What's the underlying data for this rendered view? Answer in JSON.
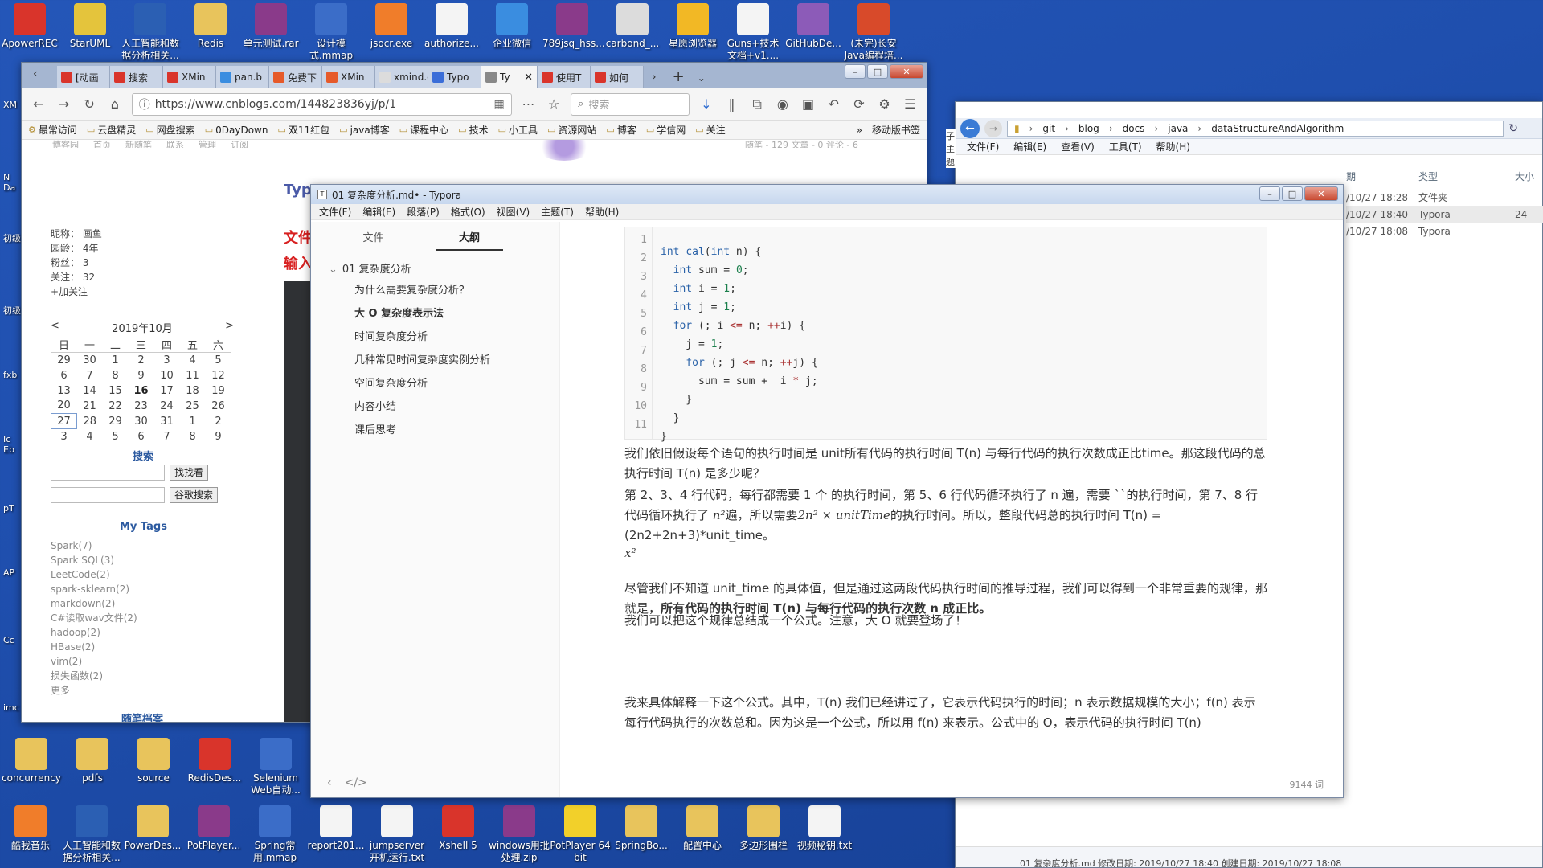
{
  "desktop": {
    "top_icons": [
      {
        "label": "ApowerREC",
        "color": "#d9342b"
      },
      {
        "label": "StarUML",
        "color": "#e4c43c"
      },
      {
        "label": "人工智能和数据分析相关...",
        "color": "#2b5fb3"
      },
      {
        "label": "Redis",
        "color": "#e8c45c"
      },
      {
        "label": "单元测试.rar",
        "color": "#8a3a8a"
      },
      {
        "label": "设计模式.mmap",
        "color": "#3b6dc8"
      },
      {
        "label": "jsocr.exe",
        "color": "#f07d2a"
      },
      {
        "label": "authorize...",
        "color": "#f4f4f4"
      },
      {
        "label": "企业微信",
        "color": "#3a8de0"
      },
      {
        "label": "789jsq_hss...",
        "color": "#8a3a8a"
      },
      {
        "label": "carbond_...",
        "color": "#dcdcdc"
      },
      {
        "label": "星愿浏览器",
        "color": "#f2b825"
      },
      {
        "label": "Guns+技术文档+v1....",
        "color": "#f4f4f4"
      },
      {
        "label": "GitHubDe...",
        "color": "#8c5bb8"
      },
      {
        "label": "(未完)长安Java编程培...",
        "color": "#d84a2a"
      }
    ],
    "left_edge_labels": [
      "XM",
      "N Da",
      "初级",
      "初级",
      "fxb",
      "Ic Eb",
      "pT",
      "AP",
      "Cc",
      "imc"
    ],
    "mid_icons": [
      {
        "label": "concurrency",
        "color": "#e8c45c"
      },
      {
        "label": "pdfs",
        "color": "#e8c45c"
      },
      {
        "label": "source",
        "color": "#e8c45c"
      },
      {
        "label": "RedisDes...",
        "color": "#d9342b"
      },
      {
        "label": "Selenium Web自动...",
        "color": "#3b6dc8"
      }
    ],
    "bottom_icons": [
      {
        "label": "酷我音乐",
        "color": "#f07d2a"
      },
      {
        "label": "人工智能和数据分析相关...",
        "color": "#2b5fb3"
      },
      {
        "label": "PowerDes...",
        "color": "#e8c45c"
      },
      {
        "label": "PotPlayer...",
        "color": "#8a3a8a"
      },
      {
        "label": "Spring常用.mmap",
        "color": "#3b6dc8"
      },
      {
        "label": "report201...",
        "color": "#f4f4f4"
      },
      {
        "label": "jumpserver开机运行.txt",
        "color": "#f4f4f4"
      },
      {
        "label": "Xshell 5",
        "color": "#d9342b"
      },
      {
        "label": "windows用批处理.zip",
        "color": "#8a3a8a"
      },
      {
        "label": "PotPlayer 64 bit",
        "color": "#f2d02a"
      },
      {
        "label": "SpringBo...",
        "color": "#e8c45c"
      },
      {
        "label": "配置中心",
        "color": "#e8c45c"
      },
      {
        "label": "多边形围栏",
        "color": "#e8c45c"
      },
      {
        "label": "视频秘钥.txt",
        "color": "#f4f4f4"
      }
    ]
  },
  "firefox": {
    "tabs": [
      {
        "label": "[动画",
        "color": "#d9342b"
      },
      {
        "label": "搜索",
        "color": "#d9342b"
      },
      {
        "label": "XMin",
        "color": "#d9342b"
      },
      {
        "label": "pan.b",
        "color": "#3a8de0"
      },
      {
        "label": "免费下",
        "color": "#e65a2a"
      },
      {
        "label": "XMin",
        "color": "#e65a2a"
      },
      {
        "label": "xmind.cn",
        "color": "#dcdcdc"
      },
      {
        "label": "Typo",
        "color": "#3a6dd8"
      },
      {
        "label": "Ty",
        "color": "#888"
      },
      {
        "label": "使用T",
        "color": "#d9342b"
      },
      {
        "label": "如何",
        "color": "#d9342b"
      }
    ],
    "url": "https://www.cnblogs.com/144823836yj/p/1",
    "search_placeholder": "搜索",
    "bookmarks": [
      "最常访问",
      "云盘精灵",
      "网盘搜索",
      "0DayDown",
      "双11红包",
      "java博客",
      "课程中心",
      "技术",
      "小工具",
      "资源网站",
      "博客",
      "学信网",
      "关注"
    ],
    "mobile_bookmarks": "移动版书签",
    "blog": {
      "nav": [
        "博客园",
        "首页",
        "新随笔",
        "联系",
        "管理",
        "订阅"
      ],
      "stats": "随笔 - 129  文章 - 0  评论 - 6",
      "profile": [
        "昵称： 画鱼",
        "园龄： 4年",
        "粉丝： 3",
        "关注： 32",
        "+加关注"
      ],
      "calendar_title": "2019年10月",
      "weekdays": [
        "日",
        "一",
        "二",
        "三",
        "四",
        "五",
        "六"
      ],
      "weeks": [
        [
          "29",
          "30",
          "1",
          "2",
          "3",
          "4",
          "5"
        ],
        [
          "6",
          "7",
          "8",
          "9",
          "10",
          "11",
          "12"
        ],
        [
          "13",
          "14",
          "15",
          "16",
          "17",
          "18",
          "19"
        ],
        [
          "20",
          "21",
          "22",
          "23",
          "24",
          "25",
          "26"
        ],
        [
          "27",
          "28",
          "29",
          "30",
          "31",
          "1",
          "2"
        ],
        [
          "3",
          "4",
          "5",
          "6",
          "7",
          "8",
          "9"
        ]
      ],
      "search_title": "搜索",
      "btn_search": "找找看",
      "btn_google": "谷歌搜索",
      "tags_title": "My Tags",
      "tags": [
        "Spark(7)",
        "Spark SQL(3)",
        "LeetCode(2)",
        "spark-sklearn(2)",
        "markdown(2)",
        "C#读取wav文件(2)",
        "hadoop(2)",
        "HBase(2)",
        "vim(2)",
        "损失函数(2)",
        "更多"
      ],
      "archive_title": "随笔档案",
      "peek_title": "Typ",
      "peek_red1": "文件",
      "peek_red2": "输入"
    }
  },
  "typora": {
    "title": "01 复杂度分析.md• - Typora",
    "menu": [
      "文件(F)",
      "编辑(E)",
      "段落(P)",
      "格式(O)",
      "视图(V)",
      "主题(T)",
      "帮助(H)"
    ],
    "side_tabs": [
      "文件",
      "大纲"
    ],
    "outline_root": "01 复杂度分析",
    "outline": [
      "为什么需要复杂度分析？",
      "大 O 复杂度表示法",
      "时间复杂度分析",
      "几种常见时间复杂度实例分析",
      "空间复杂度分析",
      "内容小结",
      "课后思考"
    ],
    "code_lines": [
      "1",
      "2",
      "3",
      "4",
      "5",
      "6",
      "7",
      "8",
      "9",
      "10",
      "11"
    ],
    "p1": "我们依旧假设每个语句的执行时间是 unit所有代码的执行时间 T(n) 与每行代码的执行次数成正比time。那这段代码的总执行时间 T(n) 是多少呢？",
    "p2a": "第 2、3、4 行代码，每行都需要 1 个 的执行时间，第 5、6 行代码循环执行了 n 遍，需要 ``的执行时间，第 7、8 行代码循环执行了 ",
    "p2_math1": "n²",
    "p2b": "遍，所以需要",
    "p2_math2": "2n² × unitTime",
    "p2c": "的执行时间。所以，整段代码总的执行时间 T(n) = (2n2+2n+3)*unit_time。",
    "math_x2": "x²",
    "p3a": "尽管我们不知道 unit_time 的具体值，但是通过这两段代码执行时间的推导过程，我们可以得到一个非常重要的规律，那就是，",
    "p3b": "所有代码的执行时间 T(n) 与每行代码的执行次数 n 成正比。",
    "p4": "我们可以把这个规律总结成一个公式。注意，大 O 就要登场了！",
    "p5": "我来具体解释一下这个公式。其中，T(n) 我们已经讲过了，它表示代码执行的时间；n 表示数据规模的大小；f(n) 表示每行代码执行的次数总和。因为这是一个公式，所以用 f(n) 来表示。公式中的 O，表示代码的执行时间 T(n)",
    "word_count": "9144 词"
  },
  "explorer": {
    "path": [
      "git",
      "blog",
      "docs",
      "java",
      "dataStructureAndAlgorithm"
    ],
    "menu": [
      "文件(F)",
      "编辑(E)",
      "查看(V)",
      "工具(T)",
      "帮助(H)"
    ],
    "columns": [
      "期",
      "类型",
      "大小"
    ],
    "rows": [
      {
        "date": "/10/27 18:28",
        "type": "文件夹",
        "size": ""
      },
      {
        "date": "/10/27 18:40",
        "type": "Typora",
        "size": "24"
      },
      {
        "date": "/10/27 18:08",
        "type": "Typora",
        "size": ""
      }
    ],
    "status": "01 复杂度分析.md  修改日期: 2019/10/27 18:40     创建日期: 2019/10/27 18:08",
    "peek": "子主题"
  }
}
